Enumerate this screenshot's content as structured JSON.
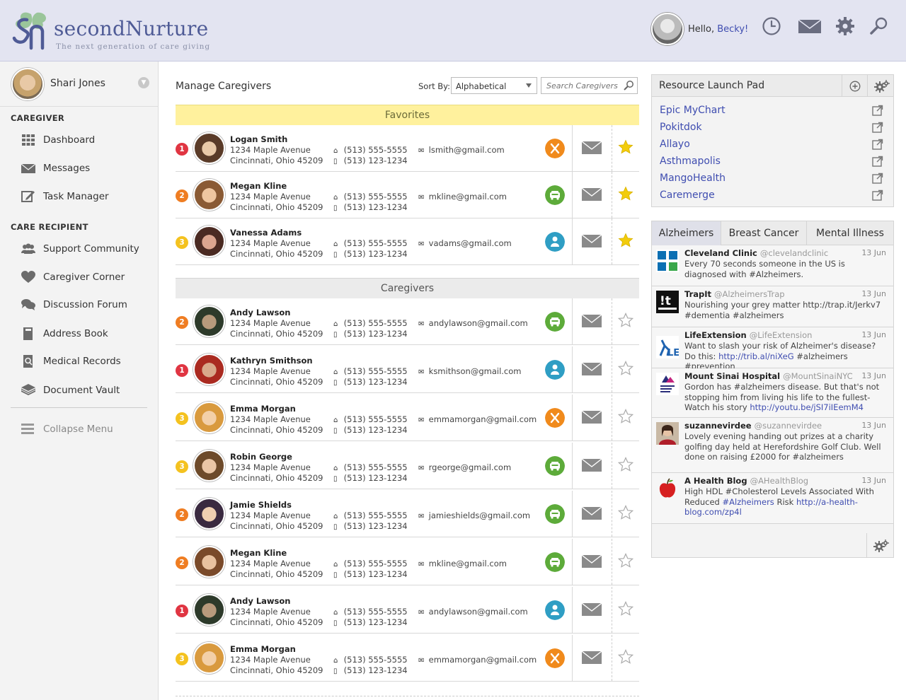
{
  "header": {
    "logo_name": "secondNurture",
    "logo_tagline": "The next generation of care giving",
    "greeting": "Hello,",
    "user_name": "Becky!",
    "icons": [
      "clock-icon",
      "mail-icon",
      "gear-icon",
      "search-icon"
    ]
  },
  "sidebar": {
    "profile_name": "Shari Jones",
    "section_caregiver": "CAREGIVER",
    "caregiver_items": [
      {
        "label": "Dashboard",
        "icon": "grid-icon"
      },
      {
        "label": "Messages",
        "icon": "envelope-icon"
      },
      {
        "label": "Task Manager",
        "icon": "edit-icon"
      }
    ],
    "section_recipient": "CARE RECIPIENT",
    "recipient_items": [
      {
        "label": "Support Community",
        "icon": "people-icon"
      },
      {
        "label": "Caregiver Corner",
        "icon": "heart-icon"
      },
      {
        "label": "Discussion Forum",
        "icon": "chat-icon"
      },
      {
        "label": "Address Book",
        "icon": "book-icon"
      },
      {
        "label": "Medical Records",
        "icon": "records-icon"
      },
      {
        "label": "Document Vault",
        "icon": "layers-icon"
      }
    ],
    "collapse_label": "Collapse Menu"
  },
  "main": {
    "title": "Manage Caregivers",
    "sort_label": "Sort By:",
    "sort_value": "Alphabetical",
    "search_placeholder": "Search Caregivers ...",
    "favorites_label": "Favorites",
    "caregivers_label": "Caregivers",
    "favorites": [
      {
        "rank": "1",
        "name": "Logan Smith",
        "address1": "1234 Maple Avenue",
        "address2": "Cincinnati, Ohio 45209",
        "home": "(513) 555-5555",
        "mobile": "(513) 123-1234",
        "email": "lsmith@gmail.com",
        "role": "meals",
        "favorite": true
      },
      {
        "rank": "2",
        "name": "Megan Kline",
        "address1": "1234 Maple Avenue",
        "address2": "Cincinnati, Ohio 45209",
        "home": "(513) 555-5555",
        "mobile": "(513) 123-1234",
        "email": "mkline@gmail.com",
        "role": "transport",
        "favorite": true
      },
      {
        "rank": "3",
        "name": "Vanessa Adams",
        "address1": "1234 Maple Avenue",
        "address2": "Cincinnati, Ohio 45209",
        "home": "(513) 555-5555",
        "mobile": "(513) 123-1234",
        "email": "vadams@gmail.com",
        "role": "person",
        "favorite": true
      }
    ],
    "caregivers": [
      {
        "rank": "2",
        "name": "Andy Lawson",
        "address1": "1234 Maple Avenue",
        "address2": "Cincinnati, Ohio 45209",
        "home": "(513) 555-5555",
        "mobile": "(513) 123-1234",
        "email": "andylawson@gmail.com",
        "role": "transport",
        "favorite": false
      },
      {
        "rank": "1",
        "name": "Kathryn Smithson",
        "address1": "1234 Maple Avenue",
        "address2": "Cincinnati, Ohio 45209",
        "home": "(513) 555-5555",
        "mobile": "(513) 123-1234",
        "email": "ksmithson@gmail.com",
        "role": "person",
        "favorite": false
      },
      {
        "rank": "3",
        "name": "Emma Morgan",
        "address1": "1234 Maple Avenue",
        "address2": "Cincinnati, Ohio 45209",
        "home": "(513) 555-5555",
        "mobile": "(513) 123-1234",
        "email": "emmamorgan@gmail.com",
        "role": "meals",
        "favorite": false
      },
      {
        "rank": "3",
        "name": "Robin George",
        "address1": "1234 Maple Avenue",
        "address2": "Cincinnati, Ohio 45209",
        "home": "(513) 555-5555",
        "mobile": "(513) 123-1234",
        "email": "rgeorge@gmail.com",
        "role": "transport",
        "favorite": false
      },
      {
        "rank": "2",
        "name": "Jamie Shields",
        "address1": "1234 Maple Avenue",
        "address2": "Cincinnati, Ohio 45209",
        "home": "(513) 555-5555",
        "mobile": "(513) 123-1234",
        "email": "jamieshields@gmail.com",
        "role": "transport",
        "favorite": false
      },
      {
        "rank": "2",
        "name": "Megan Kline",
        "address1": "1234 Maple Avenue",
        "address2": "Cincinnati, Ohio 45209",
        "home": "(513) 555-5555",
        "mobile": "(513) 123-1234",
        "email": "mkline@gmail.com",
        "role": "transport",
        "favorite": false
      },
      {
        "rank": "1",
        "name": "Andy Lawson",
        "address1": "1234 Maple Avenue",
        "address2": "Cincinnati, Ohio 45209",
        "home": "(513) 555-5555",
        "mobile": "(513) 123-1234",
        "email": "andylawson@gmail.com",
        "role": "person",
        "favorite": false
      },
      {
        "rank": "3",
        "name": "Emma Morgan",
        "address1": "1234 Maple Avenue",
        "address2": "Cincinnati, Ohio 45209",
        "home": "(513) 555-5555",
        "mobile": "(513) 123-1234",
        "email": "emmamorgan@gmail.com",
        "role": "meals",
        "favorite": false
      }
    ]
  },
  "resources": {
    "title": "Resource Launch Pad",
    "items": [
      "Epic MyChart",
      "Pokitdok",
      "Allayo",
      "Asthmapolis",
      "MangoHealth",
      "Caremerge"
    ]
  },
  "feed": {
    "tabs": [
      "Alzheimers",
      "Breast Cancer",
      "Mental Illness"
    ],
    "active_tab": "Alzheimers",
    "tweets": [
      {
        "name": "Cleveland Clinic",
        "handle": "@clevelandclinic",
        "date": "13 Jun",
        "text": "Every 70 seconds someone in the US is diagnosed with #Alzheimers.",
        "link": "",
        "tail": ""
      },
      {
        "name": "TrapIt",
        "handle": "@AlzheimersTrap",
        "date": "13 Jun",
        "text": "Nourishing your grey matter http://trap.it/Jerkv7 #dementia #alzheimers",
        "link": "",
        "tail": ""
      },
      {
        "name": "LifeExtension",
        "handle": "@LifeExtension",
        "date": "13 Jun",
        "text": "Want to slash your risk of Alzheimer's disease? Do this: ",
        "link": "http://trib.al/niXeG",
        "tail": " #alzheimers #prevention"
      },
      {
        "name": "Mount Sinai Hospital",
        "handle": "@MountSinaiNYC",
        "date": "13 Jun",
        "text": "Gordon has #alzheimers disease. But that's not stopping him from living his life to the fullest-Watch his story ",
        "link": "http://youtu.be/jSI7iIEemM4",
        "tail": ""
      },
      {
        "name": "suzannevirdee",
        "handle": "@suzannevirdee",
        "date": "13 Jun",
        "text": "Lovely evening handing out prizes at a charity golfing day held at Herefordshire Golf Club. Well done on raising £2000 for #alzheimers",
        "link": "",
        "tail": ""
      },
      {
        "name": "A Health Blog",
        "handle": "@AHealthBlog",
        "date": "13 Jun",
        "text": "High HDL #Cholesterol Levels Associated With Reduced ",
        "link": "#Alzheimers",
        "tail": " Risk ",
        "link2": "http://a-health-blog.com/zp4l"
      }
    ]
  },
  "colors": {
    "accent": "#3f4db0",
    "header_bg": "#e3e4f1",
    "favorites_bg": "#fff19d",
    "rank1": "#e03542",
    "rank2": "#ef7d22",
    "rank3": "#f4c21f",
    "role_meals": "#f08a1c",
    "role_transport": "#5dab3a",
    "role_person": "#2f9ec4",
    "star": "#f2cc0c"
  }
}
